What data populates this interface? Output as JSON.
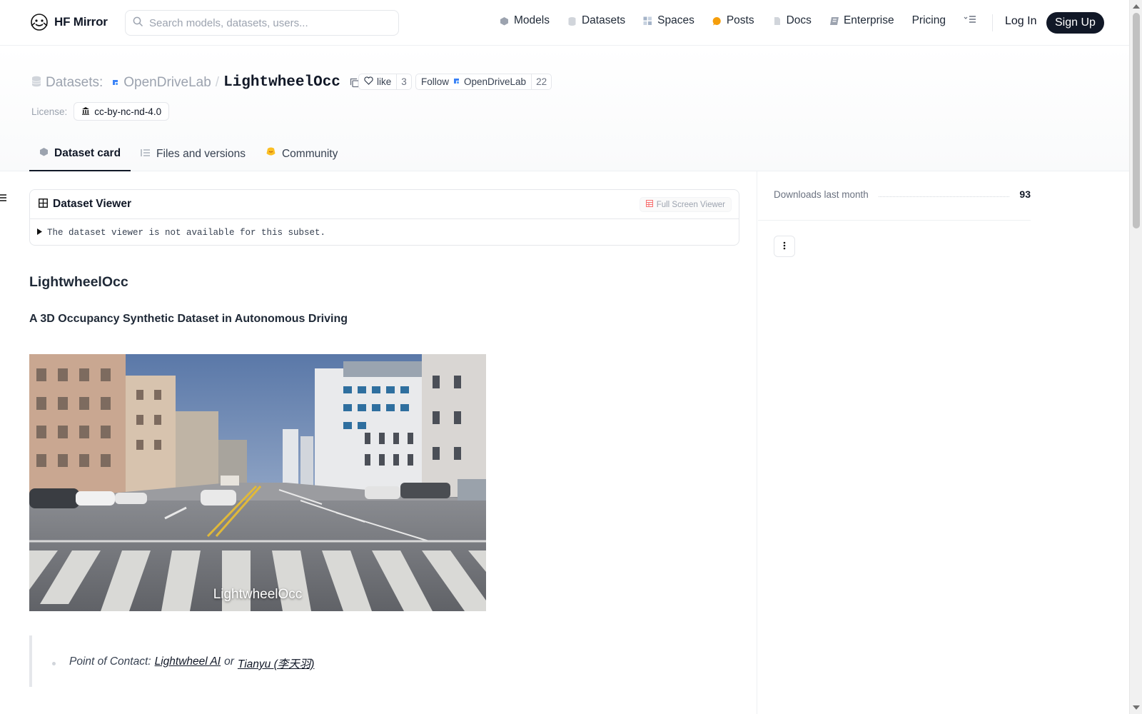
{
  "nav": {
    "brand": "HF Mirror",
    "search_placeholder": "Search models, datasets, users...",
    "links": [
      "Models",
      "Datasets",
      "Spaces",
      "Posts",
      "Docs",
      "Enterprise",
      "Pricing"
    ],
    "login": "Log In",
    "signup": "Sign Up"
  },
  "header": {
    "type_label": "Datasets:",
    "org": "OpenDriveLab",
    "slash": "/",
    "repo": "LightwheelOcc",
    "like_label": "like",
    "like_count": "3",
    "follow_label": "Follow",
    "follow_org": "OpenDriveLab",
    "follow_count": "22",
    "license_label": "License:",
    "license_value": "cc-by-nc-nd-4.0"
  },
  "tabs": [
    "Dataset card",
    "Files and versions",
    "Community"
  ],
  "viewer": {
    "title": "Dataset Viewer",
    "fullscreen": "Full Screen Viewer",
    "message": "The dataset viewer is not available for this subset."
  },
  "card": {
    "heading": "LightwheelOcc",
    "subheading": "A 3D Occupancy Synthetic Dataset in Autonomous Driving",
    "image_caption": "LightwheelOcc",
    "contact_label": "Point of Contact:",
    "contact_link1": "Lightwheel AI",
    "contact_or": "or",
    "contact_link2": "Tianyu (李天羽)"
  },
  "sidebar": {
    "downloads_label": "Downloads last month",
    "downloads_value": "93"
  },
  "colors": {
    "accent_dark": "#111827",
    "posts_dot": "#f59e0b",
    "community_emoji": "#fbbf24"
  }
}
